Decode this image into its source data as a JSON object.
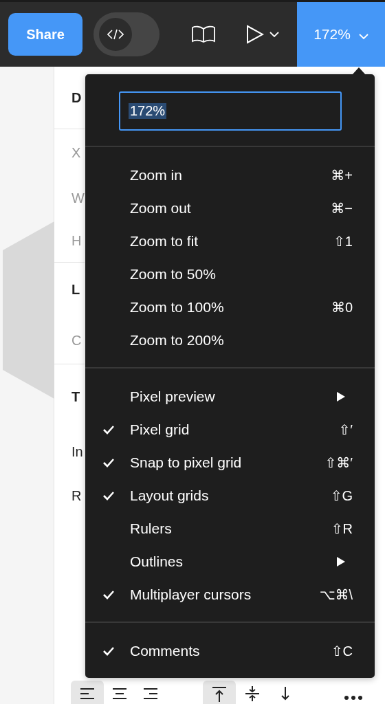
{
  "toolbar": {
    "share": "Share",
    "code_toggle": {
      "on": false
    },
    "zoom": "172%"
  },
  "panel_peek": [
    {
      "text": "D",
      "kind": "heading"
    },
    {
      "text": "X",
      "kind": "field"
    },
    {
      "text": "W",
      "kind": "field"
    },
    {
      "text": "H",
      "kind": "field"
    },
    {
      "text": "L",
      "kind": "heading"
    },
    {
      "text": "C",
      "kind": "field"
    },
    {
      "text": "T",
      "kind": "heading"
    },
    {
      "text": "In",
      "kind": "value"
    },
    {
      "text": "R",
      "kind": "value"
    }
  ],
  "zoom_menu": {
    "input": "172%",
    "groups": [
      [
        {
          "label": "Zoom in",
          "shortcut": "⌘+",
          "kind": "action",
          "checked": false
        },
        {
          "label": "Zoom out",
          "shortcut": "⌘−",
          "kind": "action",
          "checked": false
        },
        {
          "label": "Zoom to fit",
          "shortcut": "⇧1",
          "kind": "action",
          "checked": false
        },
        {
          "label": "Zoom to 50%",
          "kind": "action",
          "checked": false
        },
        {
          "label": "Zoom to 100%",
          "shortcut": "⌘0",
          "kind": "action",
          "checked": false
        },
        {
          "label": "Zoom to 200%",
          "kind": "action",
          "checked": false
        }
      ],
      [
        {
          "label": "Pixel preview",
          "kind": "submenu",
          "checked": false
        },
        {
          "label": "Pixel grid",
          "shortcut": "⇧′",
          "kind": "action",
          "checked": true
        },
        {
          "label": "Snap to pixel grid",
          "shortcut": "⇧⌘′",
          "kind": "action",
          "checked": true
        },
        {
          "label": "Layout grids",
          "shortcut": "⇧G",
          "kind": "action",
          "checked": true
        },
        {
          "label": "Rulers",
          "shortcut": "⇧R",
          "kind": "action",
          "checked": false
        },
        {
          "label": "Outlines",
          "kind": "submenu",
          "checked": false
        },
        {
          "label": "Multiplayer cursors",
          "shortcut": "⌥⌘\\",
          "kind": "action",
          "checked": true
        }
      ],
      [
        {
          "label": "Comments",
          "shortcut": "⇧C",
          "kind": "action",
          "checked": true
        }
      ]
    ]
  },
  "text_align": [
    {
      "kind": "left",
      "selected": true
    },
    {
      "kind": "center",
      "selected": false
    },
    {
      "kind": "right",
      "selected": false
    }
  ],
  "vertical_align": [
    {
      "kind": "top",
      "selected": true
    },
    {
      "kind": "middle",
      "selected": false
    },
    {
      "kind": "bottom",
      "selected": false
    }
  ]
}
